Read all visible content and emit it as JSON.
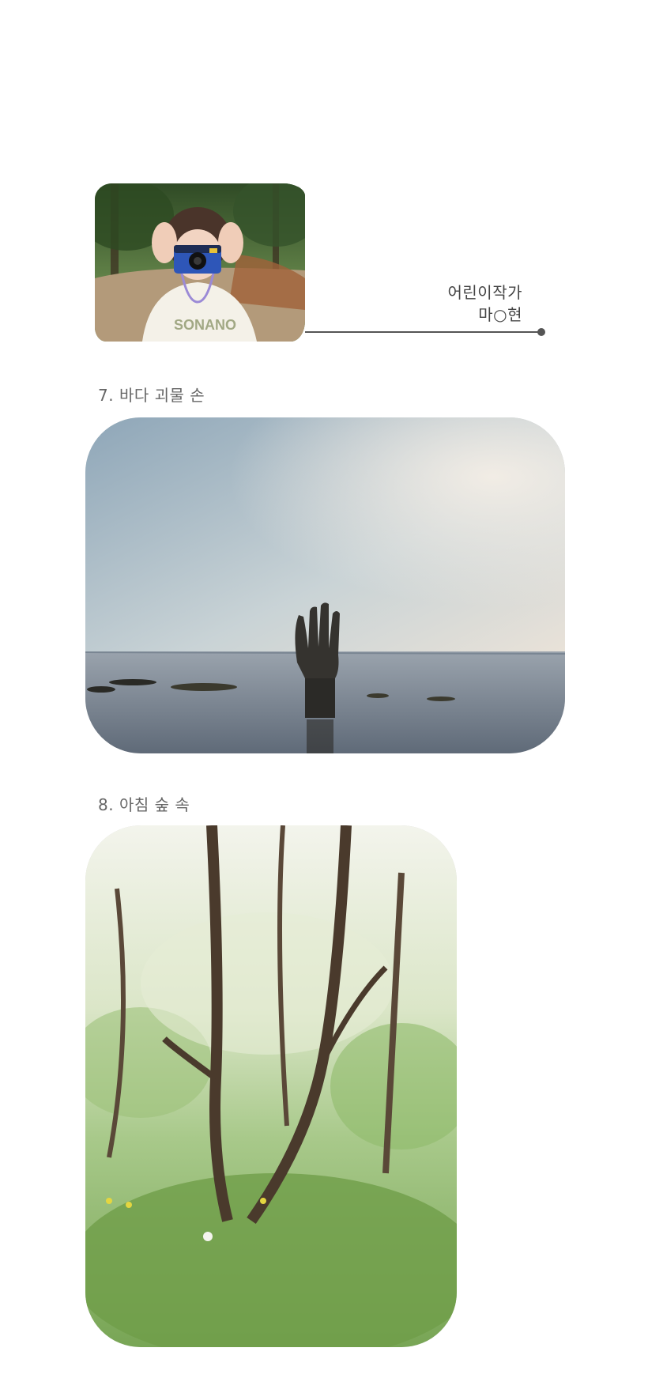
{
  "author": {
    "role": "어린이작가",
    "name": "마○현",
    "photo_icon": "child-with-camera-photo"
  },
  "photos": [
    {
      "title": "7. 바다 괴물 손",
      "icon": "sea-hand-sculpture-photo"
    },
    {
      "title": "8. 아침 숲 속",
      "icon": "morning-forest-photo"
    }
  ],
  "colors": {
    "text": "#555555",
    "line": "#555555",
    "background": "#ffffff"
  }
}
